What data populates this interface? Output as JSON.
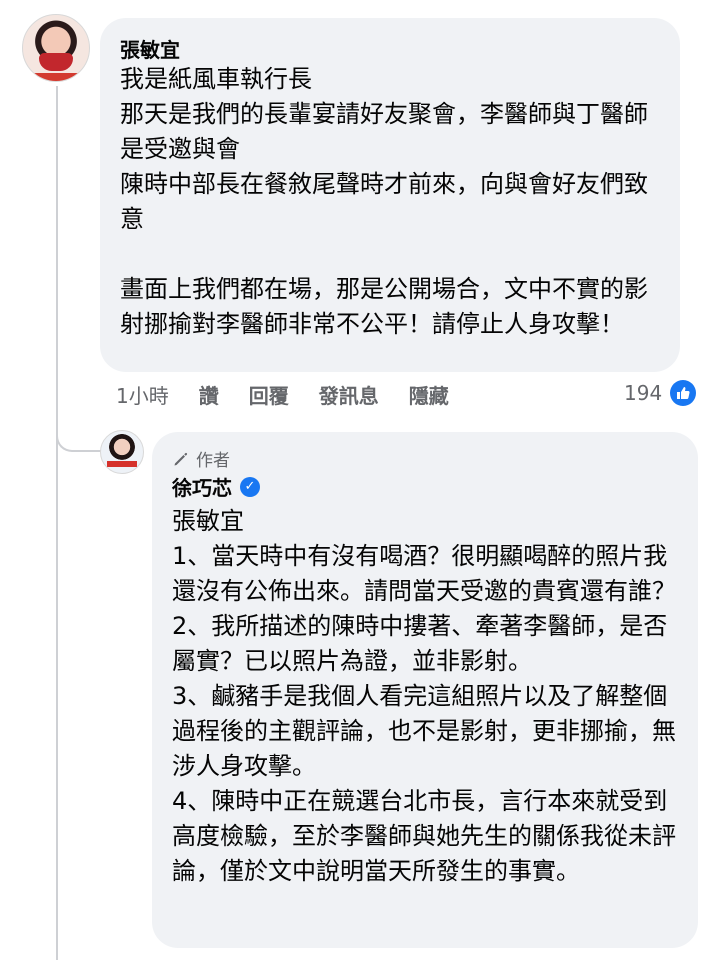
{
  "comment": {
    "author": "張敏宜",
    "body": "我是紙風車執行長\n那天是我們的長輩宴請好友聚會，李醫師與丁醫師是受邀與會\n陳時中部長在餐敘尾聲時才前來，向與會好友們致意\n\n畫面上我們都在場，那是公開場合，文中不實的影射挪揄對李醫師非常不公平！請停止人身攻擊！",
    "time": "1小時",
    "actions": [
      "讚",
      "回覆",
      "發訊息",
      "隱藏"
    ],
    "like_count": "194"
  },
  "reply": {
    "author_badge": "作者",
    "author": "徐巧芯",
    "body": "張敏宜\n1、當天時中有沒有喝酒？很明顯喝醉的照片我還沒有公佈出來。請問當天受邀的貴賓還有誰？\n2、我所描述的陳時中摟著、牽著李醫師，是否屬實？已以照片為證，並非影射。\n3、鹹豬手是我個人看完這組照片以及了解整個過程後的主觀評論，也不是影射，更非挪揄，無涉人身攻擊。\n4、陳時中正在競選台北市長，言行本來就受到高度檢驗，至於李醫師與她先生的關係我從未評論，僅於文中說明當天所發生的事實。"
  },
  "icons": {
    "like": "thumbs-up-icon",
    "author_badge": "pen-icon",
    "verified": "verified-check-icon"
  },
  "colors": {
    "bubble": "#f0f2f5",
    "meta_text": "#65676b",
    "accent": "#1877f2"
  }
}
